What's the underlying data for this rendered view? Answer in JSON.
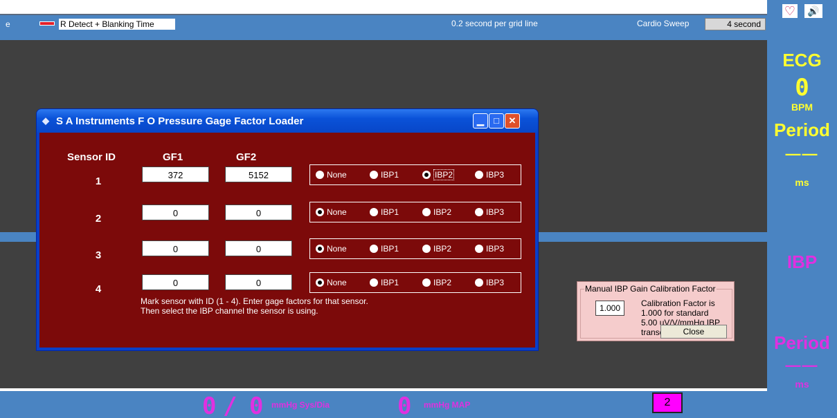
{
  "topbar": {
    "cut_text": "e",
    "legend_label": "R Detect + Blanking Time",
    "grid_text": "0.2 second per grid line",
    "sweep_label": "Cardio Sweep",
    "sweep_value": "4 second"
  },
  "icons": {
    "heart": "♡",
    "speaker": "🔊"
  },
  "ecg_side": {
    "title": "ECG",
    "value": "0",
    "unit": "BPM",
    "period_label": "Period",
    "period_value": "——",
    "period_unit": "ms"
  },
  "ibp_side": {
    "title": "IBP",
    "period_label": "Period",
    "period_value": "——",
    "period_unit": "ms"
  },
  "bottombar": {
    "sys": "0",
    "slash": "/",
    "dia": "0",
    "sysdia_label": "mmHg Sys/Dia",
    "map": "0",
    "map_label": "mmHg MAP",
    "channel": "2"
  },
  "dialog": {
    "title": "S A Instruments F O Pressure Gage Factor Loader",
    "headers": {
      "sensor_id": "Sensor ID",
      "gf1": "GF1",
      "gf2": "GF2"
    },
    "rows": [
      {
        "id": "1",
        "gf1": "372",
        "gf2": "5152",
        "selected": "IBP2"
      },
      {
        "id": "2",
        "gf1": "0",
        "gf2": "0",
        "selected": "None"
      },
      {
        "id": "3",
        "gf1": "0",
        "gf2": "0",
        "selected": "None"
      },
      {
        "id": "4",
        "gf1": "0",
        "gf2": "0",
        "selected": "None"
      }
    ],
    "options": [
      "None",
      "IBP1",
      "IBP2",
      "IBP3"
    ],
    "instructions_line1": "Mark sensor with ID (1 - 4).  Enter gage factors for that sensor.",
    "instructions_line2": "Then select the IBP channel the sensor is using."
  },
  "calibration": {
    "title": "Manual IBP Gain Calibration Factor",
    "value": "1.000",
    "desc_line1": "Calibration Factor is 1.000 for standard",
    "desc_line2": "5.00 uV/V/mmHg IBP transducers.",
    "close_label": "Close"
  },
  "colors": {
    "accent": "#4a84c2",
    "panel": "#404040",
    "dialog_bg": "#7c0a0a",
    "ecg": "#ffff30",
    "ibp": "#e030e0"
  }
}
